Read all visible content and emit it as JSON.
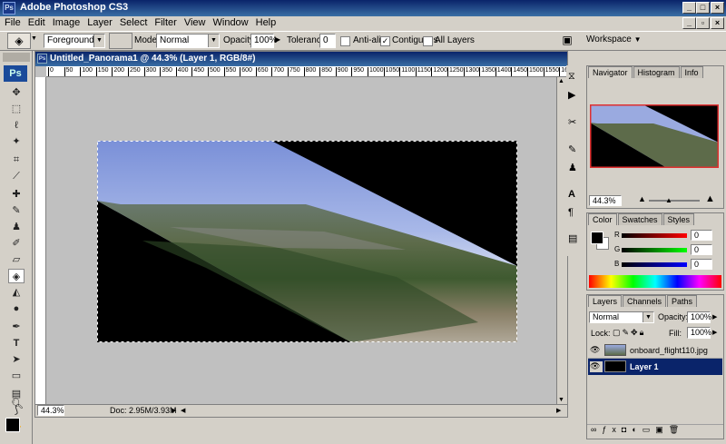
{
  "app": {
    "title": "Adobe Photoshop CS3",
    "logo": "Ps"
  },
  "menu": [
    "File",
    "Edit",
    "Image",
    "Layer",
    "Select",
    "Filter",
    "View",
    "Window",
    "Help"
  ],
  "options": {
    "fill_source": "Foreground",
    "mode_label": "Mode:",
    "mode_value": "Normal",
    "opacity_label": "Opacity:",
    "opacity_value": "100%",
    "tolerance_label": "Tolerance:",
    "tolerance_value": "0",
    "antialias_label": "Anti-alias",
    "contiguous_label": "Contiguous",
    "all_layers_label": "All Layers",
    "workspace_label": "Workspace"
  },
  "document": {
    "title": "Untitled_Panorama1 @ 44.3% (Layer 1, RGB/8#)",
    "zoom": "44.3%",
    "doc_info": "Doc: 2.95M/3.93M",
    "ruler_ticks": [
      "0",
      "50",
      "100",
      "150",
      "200",
      "250",
      "300",
      "350",
      "400",
      "450",
      "500",
      "550",
      "600",
      "650",
      "700",
      "750",
      "800",
      "850",
      "900",
      "950",
      "1000",
      "1050",
      "1100",
      "1150",
      "1200",
      "1250",
      "1300",
      "1350",
      "1400",
      "1450",
      "1500",
      "1550",
      "160"
    ]
  },
  "navigator": {
    "tabs": [
      "Navigator",
      "Histogram",
      "Info"
    ],
    "zoom": "44.3%"
  },
  "color": {
    "tabs": [
      "Color",
      "Swatches",
      "Styles"
    ],
    "r_label": "R",
    "g_label": "G",
    "b_label": "B",
    "r": "0",
    "g": "0",
    "b": "0"
  },
  "layers": {
    "tabs": [
      "Layers",
      "Channels",
      "Paths"
    ],
    "blend_mode": "Normal",
    "opacity_label": "Opacity:",
    "opacity": "100%",
    "lock_label": "Lock:",
    "fill_label": "Fill:",
    "fill": "100%",
    "items": [
      {
        "name": "onboard_flight110.jpg",
        "selected": false
      },
      {
        "name": "Layer 1",
        "selected": true
      }
    ]
  }
}
